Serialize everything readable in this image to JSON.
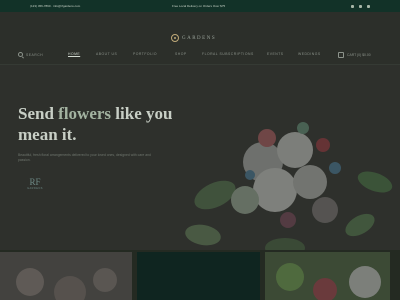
{
  "topbar": {
    "contact": "(123) 456-7890 · info@rfgardens.com",
    "promo": "Free Local Delivery on Orders Over $75",
    "social_icons": [
      "facebook-icon",
      "instagram-icon",
      "pinterest-icon"
    ]
  },
  "logo": {
    "text": "GARDENS"
  },
  "nav": {
    "search_label": "SEARCH",
    "items": [
      "HOME",
      "ABOUT US",
      "PORTFOLIO",
      "SHOP",
      "FLORAL SUBSCRIPTIONS",
      "EVENTS",
      "WEDDINGS"
    ],
    "active": "HOME",
    "cart_label": "CART (0) $0.00"
  },
  "hero": {
    "headline_before": "Send ",
    "headline_accent": "flowers",
    "headline_after": " like you mean it.",
    "subtext": "Beautiful, fresh floral arrangements delivered to your loved ones, designed with care and passion.",
    "logo_mark": "RF",
    "logo_sub": "GARDENS"
  },
  "colors": {
    "topbar": "#123228",
    "header_bg": "#2c2f2a",
    "hero_bg": "#2e302c",
    "accent": "#bfa978",
    "card_dark": "#0f2520"
  }
}
